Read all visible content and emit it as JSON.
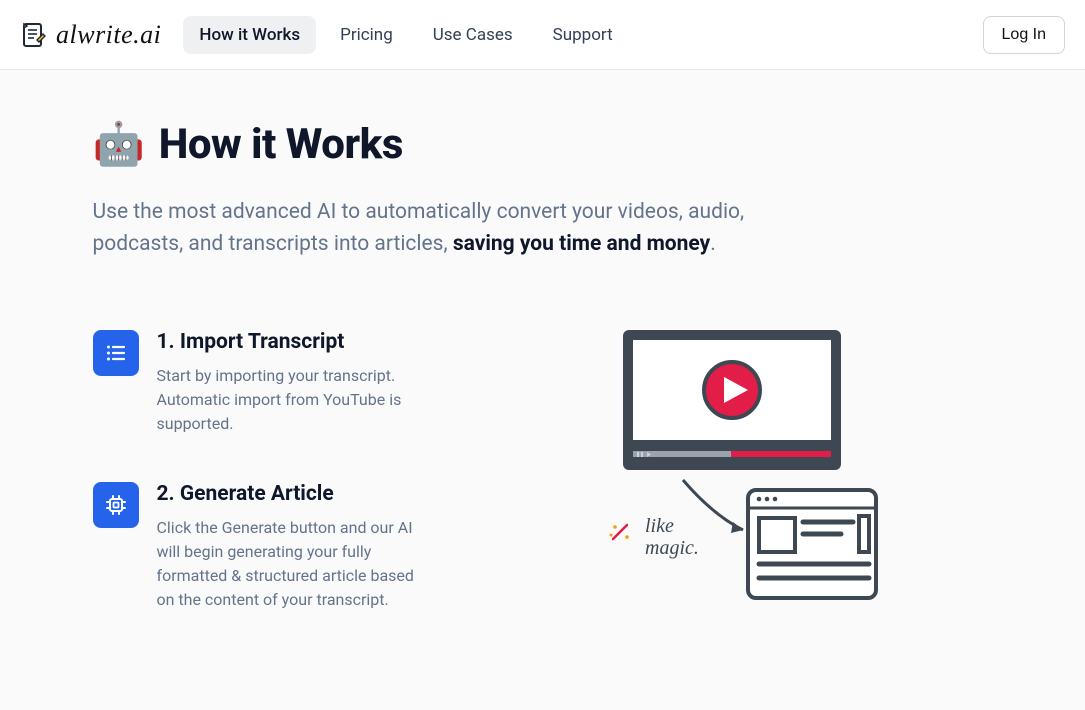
{
  "brand": {
    "name": "alwrite.ai"
  },
  "nav": {
    "items": [
      {
        "label": "How it Works",
        "active": true
      },
      {
        "label": "Pricing",
        "active": false
      },
      {
        "label": "Use Cases",
        "active": false
      },
      {
        "label": "Support",
        "active": false
      }
    ],
    "login_label": "Log In"
  },
  "page": {
    "emoji": "🤖",
    "title": "How it Works",
    "subtitle_pre": "Use the most advanced AI to automatically convert your videos, audio, podcasts, and transcripts into articles, ",
    "subtitle_strong": "saving you time and money",
    "subtitle_post": "."
  },
  "steps": [
    {
      "heading": "1. Import Transcript",
      "body": "Start by importing your transcript. Automatic import from YouTube is supported."
    },
    {
      "heading": "2. Generate Article",
      "body": "Click the Generate button and our AI will begin generating your fully formatted & structured article based on the content of your transcript."
    }
  ],
  "illustration": {
    "caption_line1": "like",
    "caption_line2": "magic."
  }
}
